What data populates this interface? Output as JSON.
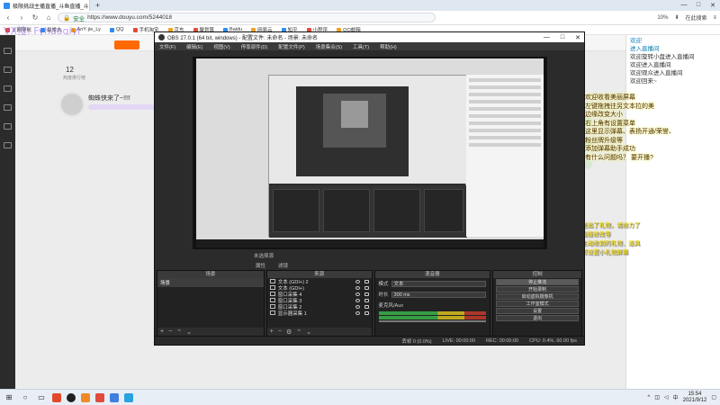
{
  "browser": {
    "tab_title": "极限挑战主播直播_斗鱼直播_斗鱼",
    "new_tab": "+",
    "window_controls": [
      "—",
      "□",
      "✕"
    ],
    "url": "https://www.douyu.com/5244018",
    "security": "安全",
    "zoom": "10%",
    "download_label": "在此搜索",
    "bookmarks": [
      "上网导航",
      "最常去",
      "AnY·jie_Ly",
      "QQ",
      "手机淘宝",
      "京东",
      "聚划算",
      "Baidu",
      "网易云",
      "知乎",
      "小程序",
      "QQ邮箱"
    ]
  },
  "watermark": "VX搜: Fyhaoqiyi",
  "douyu": {
    "hot_number": "12",
    "hot_sub": "热度排行榜",
    "room_title": "蜘蛛侠来了~!!!!"
  },
  "chat": [
    {
      "text": "欢迎",
      "cls": "sys"
    },
    {
      "text": "进入直播间",
      "cls": "sys"
    },
    {
      "text": "欢迎旋转小盘进入直播间",
      "cls": ""
    },
    {
      "text": "欢迎进入直播间",
      "cls": ""
    },
    {
      "text": "欢迎观众进入直播间",
      "cls": ""
    },
    {
      "text": "欢迎回来~",
      "cls": ""
    }
  ],
  "overlay": [
    "欢迎收看美丽屏幕",
    "左键拖拽往另文本拉的美",
    "边缘改变大小",
    "右上角有设置菜单",
    "这里显示弹幕、表扬开通/荣誉、",
    "粉丝牌升级等",
    "添加弹幕助手成功",
    "有什么问题吗？ 要开播?"
  ],
  "bottom_overlay": [
    "主播手动送出了礼物，请给力了",
    "屏幕支持直接修改等",
    "这里显示主动收到的礼物、道具",
    "主播点歌可设置小礼物屏幕"
  ],
  "obs": {
    "title": "OBS 27.0.1 (64 bit, windows) - 配置文件: 未命名 - 场景: 未命名",
    "menu": [
      "文件(F)",
      "编辑(E)",
      "视图(V)",
      "停靠部件(D)",
      "配置文件(P)",
      "场景集合(S)",
      "工具(T)",
      "帮助(H)"
    ],
    "toggle_labels": [
      "属性",
      "滤镜"
    ],
    "docks": {
      "scenes_head": "场景",
      "sources_head": "来源",
      "mixer_head": "混音器",
      "controls_head": "控制"
    },
    "no_source": "未选择源",
    "scenes": [
      "场景"
    ],
    "sources": [
      "文本 (GDI+) 2",
      "文本 (GDI+)",
      "窗口采集 4",
      "窗口采集 3",
      "窗口采集 2",
      "显示器采集 1"
    ],
    "mixer_field1_label": "模式",
    "mixer_field1_value": "文本",
    "mixer_field2_label": "时长",
    "mixer_field2_value": "300 ms",
    "audio_label": "麦克风/Aux",
    "controls": [
      "停止推流",
      "开始录制",
      "启动虚拟摄像机",
      "工作室模式",
      "设置",
      "退出"
    ],
    "status": [
      "丢帧 0 (0.0%)",
      "LIVE: 00:00:00",
      "REC: 00:00:00",
      "CPU: 0.4%, 60.00 fps"
    ]
  },
  "taskbar": {
    "time": "15:54",
    "date": "2021/9/12",
    "lang": "中"
  }
}
